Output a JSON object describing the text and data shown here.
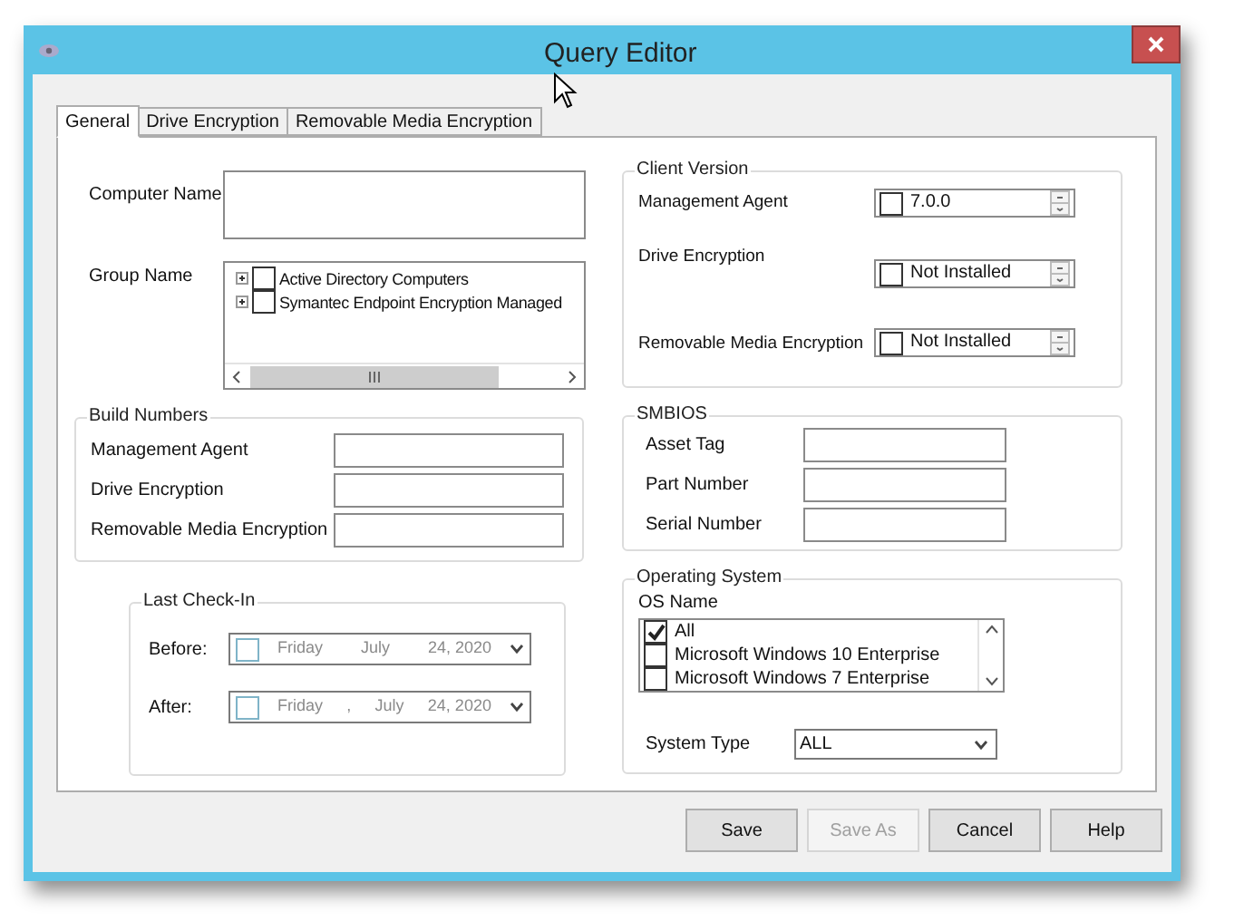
{
  "window": {
    "title": "Query Editor"
  },
  "tabs": [
    {
      "label": "General",
      "selected": true
    },
    {
      "label": "Drive Encryption",
      "selected": false
    },
    {
      "label": "Removable Media Encryption",
      "selected": false
    }
  ],
  "computer_name": {
    "label": "Computer Name"
  },
  "group_name": {
    "label": "Group Name",
    "tree": [
      {
        "label": "Active Directory Computers",
        "checked": false,
        "expanded": false
      },
      {
        "label": "Symantec Endpoint Encryption Managed",
        "checked": false,
        "expanded": false
      }
    ]
  },
  "build_numbers": {
    "title": "Build Numbers",
    "fields": [
      {
        "label": "Management Agent"
      },
      {
        "label": "Drive Encryption"
      },
      {
        "label": "Removable Media Encryption"
      }
    ]
  },
  "last_check_in": {
    "title": "Last Check-In",
    "rows": [
      {
        "label": "Before:",
        "checked": false,
        "parts": [
          "Friday",
          "July",
          "24, 2020"
        ]
      },
      {
        "label": "After:",
        "checked": false,
        "parts": [
          "Friday",
          ",",
          "July",
          "24, 2020"
        ]
      }
    ]
  },
  "client_version": {
    "title": "Client Version",
    "rows": [
      {
        "label": "Management Agent",
        "checked": false,
        "value": "7.0.0"
      },
      {
        "label": "Drive Encryption",
        "checked": false,
        "value": "Not Installed"
      },
      {
        "label": "Removable Media Encryption",
        "checked": false,
        "value": "Not Installed"
      }
    ]
  },
  "smbios": {
    "title": "SMBIOS",
    "fields": [
      {
        "label": "Asset Tag"
      },
      {
        "label": "Part Number"
      },
      {
        "label": "Serial Number"
      }
    ]
  },
  "operating_system": {
    "title": "Operating System",
    "os_name_label": "OS Name",
    "options": [
      {
        "label": "All",
        "checked": true
      },
      {
        "label": "Microsoft Windows 10 Enterprise",
        "checked": false
      },
      {
        "label": "Microsoft Windows 7 Enterprise",
        "checked": false
      }
    ],
    "system_type": {
      "label": "System Type",
      "value": "ALL"
    }
  },
  "buttons": [
    {
      "label": "Save",
      "disabled": false
    },
    {
      "label": "Save As",
      "disabled": true
    },
    {
      "label": "Cancel",
      "disabled": false
    },
    {
      "label": "Help",
      "disabled": false
    }
  ]
}
